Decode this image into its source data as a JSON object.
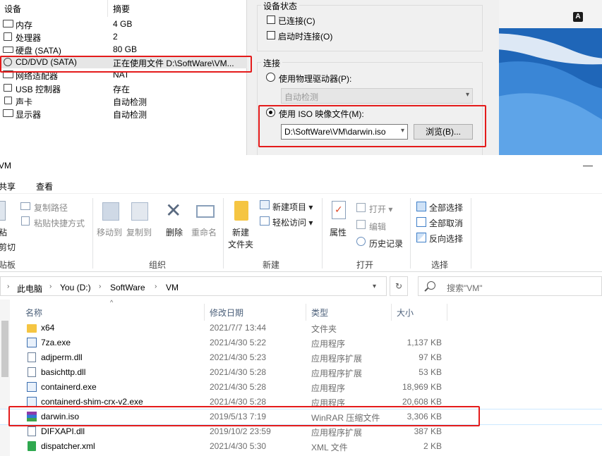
{
  "hardware_list": {
    "headers": {
      "device": "设备",
      "summary": "摘要"
    },
    "items": [
      {
        "name": "内存",
        "value": "4 GB",
        "icon": "memory-icon"
      },
      {
        "name": "处理器",
        "value": "2",
        "icon": "cpu-icon"
      },
      {
        "name": "硬盘 (SATA)",
        "value": "80 GB",
        "icon": "harddisk-icon"
      },
      {
        "name": "CD/DVD (SATA)",
        "value": "正在使用文件 D:\\SoftWare\\VM...",
        "icon": "cd-dvd-icon"
      },
      {
        "name": "网络适配器",
        "value": "NAT",
        "icon": "network-adapter-icon"
      },
      {
        "name": "USB 控制器",
        "value": "存在",
        "icon": "usb-icon"
      },
      {
        "name": "声卡",
        "value": "自动检测",
        "icon": "sound-card-icon"
      },
      {
        "name": "显示器",
        "value": "自动检测",
        "icon": "display-icon"
      }
    ]
  },
  "device_status": {
    "title": "设备状态",
    "connected": "已连接(C)",
    "connect_on_power": "启动时连接(O)"
  },
  "connection": {
    "title": "连接",
    "physical_drive": "使用物理驱动器(P):",
    "physical_drive_value": "自动检测",
    "iso_image": "使用 ISO 映像文件(M):",
    "iso_path": "D:\\SoftWare\\VM\\darwin.iso",
    "browse": "浏览(B)..."
  },
  "desktop": {
    "lang_indicator": "A"
  },
  "explorer": {
    "window_title": "VM",
    "tabs": [
      "共享",
      "查看"
    ],
    "ribbon": {
      "clipboard": {
        "copy_path": "复制路径",
        "paste_shortcut": "粘贴快捷方式",
        "paste": "粘",
        "cut": "剪切",
        "group": "贴板"
      },
      "organize": {
        "move_to": "移动到",
        "copy_to": "复制到",
        "delete": "删除",
        "rename": "重命名",
        "group": "组织"
      },
      "new": {
        "new_item": "新建项目 ▾",
        "easy_access": "轻松访问 ▾",
        "new_folder_1": "新建",
        "new_folder_2": "文件夹",
        "group": "新建"
      },
      "open": {
        "properties": "属性",
        "open": "打开 ▾",
        "edit": "编辑",
        "history": "历史记录",
        "group": "打开"
      },
      "select": {
        "select_all": "全部选择",
        "select_none": "全部取消",
        "invert": "反向选择",
        "group": "选择"
      }
    },
    "breadcrumb": [
      "此电脑",
      "You (D:)",
      "SoftWare",
      "VM"
    ],
    "search_placeholder": "搜索\"VM\"",
    "columns": {
      "name": "名称",
      "date": "修改日期",
      "type": "类型",
      "size": "大小"
    },
    "files": [
      {
        "name": "x64",
        "date": "2021/7/7 13:44",
        "type": "文件夹",
        "size": "",
        "icon": "folder-icon"
      },
      {
        "name": "7za.exe",
        "date": "2021/4/30 5:22",
        "type": "应用程序",
        "size": "1,137 KB",
        "icon": "exe-icon"
      },
      {
        "name": "adjperm.dll",
        "date": "2021/4/30 5:23",
        "type": "应用程序扩展",
        "size": "97 KB",
        "icon": "dll-icon"
      },
      {
        "name": "basichttp.dll",
        "date": "2021/4/30 5:28",
        "type": "应用程序扩展",
        "size": "53 KB",
        "icon": "dll-icon"
      },
      {
        "name": "containerd.exe",
        "date": "2021/4/30 5:28",
        "type": "应用程序",
        "size": "18,969 KB",
        "icon": "exe-icon"
      },
      {
        "name": "containerd-shim-crx-v2.exe",
        "date": "2021/4/30 5:28",
        "type": "应用程序",
        "size": "20,608 KB",
        "icon": "exe-icon"
      },
      {
        "name": "darwin.iso",
        "date": "2019/5/13 7:19",
        "type": "WinRAR 压缩文件",
        "size": "3,306 KB",
        "icon": "winrar-icon"
      },
      {
        "name": "DIFXAPI.dll",
        "date": "2019/10/2 23:59",
        "type": "应用程序扩展",
        "size": "387 KB",
        "icon": "dll-icon"
      },
      {
        "name": "dispatcher.xml",
        "date": "2021/4/30 5:30",
        "type": "XML 文件",
        "size": "2 KB",
        "icon": "xml-icon"
      }
    ]
  },
  "colors": {
    "highlight": "#e41b1b",
    "accent": "#1f66b8",
    "folder": "#f5c542"
  }
}
